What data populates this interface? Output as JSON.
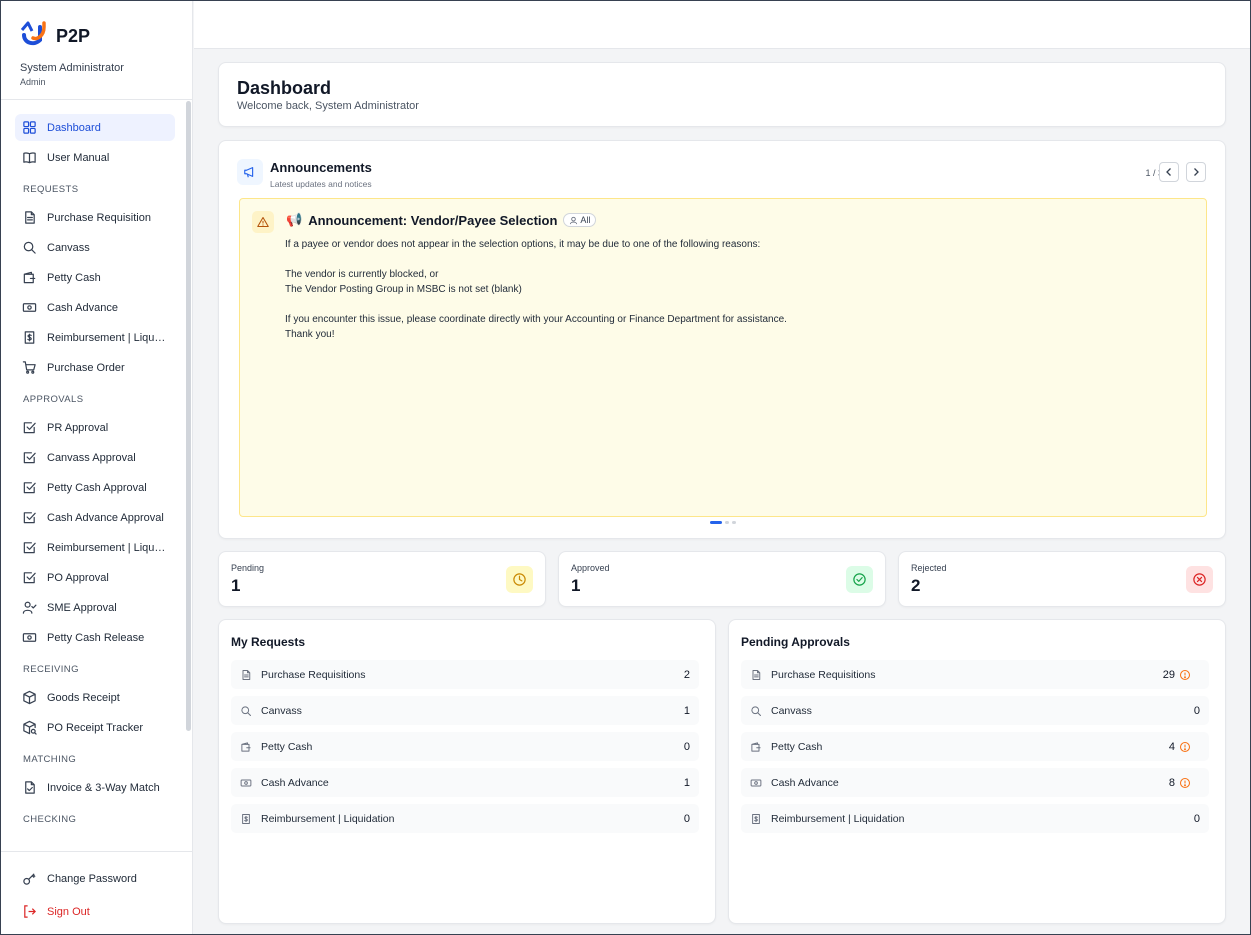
{
  "app": {
    "name": "P2P",
    "user_name": "System Administrator",
    "user_role": "Admin",
    "logo_colors": {
      "orange": "#f97316",
      "blue": "#1d4ed8"
    }
  },
  "sidebar": {
    "top_items": [
      {
        "label": "Dashboard",
        "icon": "dashboard-icon",
        "active": true
      },
      {
        "label": "User Manual",
        "icon": "book-icon"
      }
    ],
    "sections": [
      {
        "title": "REQUESTS",
        "items": [
          {
            "label": "Purchase Requisition",
            "icon": "document-icon"
          },
          {
            "label": "Canvass",
            "icon": "search-icon"
          },
          {
            "label": "Petty Cash",
            "icon": "wallet-icon"
          },
          {
            "label": "Cash Advance",
            "icon": "banknote-icon"
          },
          {
            "label": "Reimbursement | Liquidation",
            "icon": "receipt-icon"
          },
          {
            "label": "Purchase Order",
            "icon": "cart-icon"
          }
        ]
      },
      {
        "title": "APPROVALS",
        "items": [
          {
            "label": "PR Approval",
            "icon": "check-square-icon"
          },
          {
            "label": "Canvass Approval",
            "icon": "check-square-icon"
          },
          {
            "label": "Petty Cash Approval",
            "icon": "check-square-icon"
          },
          {
            "label": "Cash Advance Approval",
            "icon": "check-square-icon"
          },
          {
            "label": "Reimbursement | Liquidation Approval",
            "icon": "check-square-icon"
          },
          {
            "label": "PO Approval",
            "icon": "check-square-icon"
          },
          {
            "label": "SME Approval",
            "icon": "user-check-icon"
          },
          {
            "label": "Petty Cash Release",
            "icon": "banknote-icon"
          }
        ]
      },
      {
        "title": "RECEIVING",
        "items": [
          {
            "label": "Goods Receipt",
            "icon": "package-icon"
          },
          {
            "label": "PO Receipt Tracker",
            "icon": "package-search-icon"
          }
        ]
      },
      {
        "title": "MATCHING",
        "items": [
          {
            "label": "Invoice & 3-Way Match",
            "icon": "file-check-icon"
          }
        ]
      },
      {
        "title": "CHECKING",
        "items": []
      }
    ],
    "footer": {
      "change_password": "Change Password",
      "sign_out": "Sign Out"
    }
  },
  "dashboard": {
    "title": "Dashboard",
    "subtitle": "Welcome back, System Administrator"
  },
  "announcements": {
    "title": "Announcements",
    "subtitle": "Latest updates and notices",
    "counter": "1 / 3",
    "current_index": 1,
    "total": 3,
    "item": {
      "emoji": "📢",
      "title": "Announcement: Vendor/Payee Selection",
      "audience": "All",
      "lines": [
        "If a payee or vendor does not appear in the selection options, it may be due to one of the following reasons:",
        "",
        "The vendor is currently blocked, or",
        "The Vendor Posting Group in MSBC is not set (blank)",
        "",
        "If you encounter this issue, please coordinate directly with your Accounting or Finance Department for assistance.",
        "Thank you!"
      ]
    }
  },
  "stats": [
    {
      "label": "Pending",
      "value": "1",
      "icon": "clock-icon",
      "bg": "#fef9c3",
      "color": "#ca8a04"
    },
    {
      "label": "Approved",
      "value": "1",
      "icon": "check-circle-icon",
      "bg": "#dcfce7",
      "color": "#16a34a"
    },
    {
      "label": "Rejected",
      "value": "2",
      "icon": "x-circle-icon",
      "bg": "#fee2e2",
      "color": "#dc2626"
    }
  ],
  "my_requests": {
    "title": "My Requests",
    "rows": [
      {
        "label": "Purchase Requisitions",
        "count": "2",
        "icon": "document-icon"
      },
      {
        "label": "Canvass",
        "count": "1",
        "icon": "search-icon"
      },
      {
        "label": "Petty Cash",
        "count": "0",
        "icon": "wallet-icon"
      },
      {
        "label": "Cash Advance",
        "count": "1",
        "icon": "banknote-icon"
      },
      {
        "label": "Reimbursement | Liquidation",
        "count": "0",
        "icon": "receipt-icon"
      }
    ]
  },
  "pending_approvals": {
    "title": "Pending Approvals",
    "rows": [
      {
        "label": "Purchase Requisitions",
        "count": "29",
        "icon": "document-icon",
        "alert": true
      },
      {
        "label": "Canvass",
        "count": "0",
        "icon": "search-icon",
        "alert": false
      },
      {
        "label": "Petty Cash",
        "count": "4",
        "icon": "wallet-icon",
        "alert": true
      },
      {
        "label": "Cash Advance",
        "count": "8",
        "icon": "banknote-icon",
        "alert": true
      },
      {
        "label": "Reimbursement | Liquidation",
        "count": "0",
        "icon": "receipt-icon",
        "alert": false
      }
    ]
  }
}
